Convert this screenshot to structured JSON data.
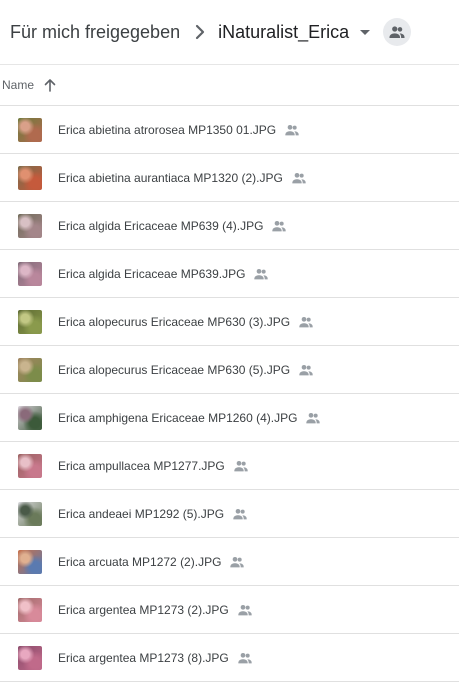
{
  "breadcrumb": {
    "root": "Für mich freigegeben",
    "current": "iNaturalist_Erica",
    "icons": {
      "separator": "chevron-right-icon",
      "dropdown": "caret-down-icon",
      "shared": "people-icon"
    }
  },
  "list_header": {
    "column_name": "Name",
    "sort_direction": "ascending",
    "sort_icon": "arrow-up-icon"
  },
  "files": [
    {
      "name": "Erica abietina atrorosea MP1350 01.JPG",
      "shared": true,
      "thumb_colors": [
        "#b06a4e",
        "#6e7a3c",
        "#d9a089"
      ]
    },
    {
      "name": "Erica abietina aurantiaca MP1320 (2).JPG",
      "shared": true,
      "thumb_colors": [
        "#c55a3c",
        "#7a6b4a",
        "#e09070"
      ]
    },
    {
      "name": "Erica algida Ericaceae MP639 (4).JPG",
      "shared": true,
      "thumb_colors": [
        "#a4868a",
        "#6f6a58",
        "#d8c0c4"
      ]
    },
    {
      "name": "Erica algida Ericaceae MP639.JPG",
      "shared": true,
      "thumb_colors": [
        "#b9879c",
        "#806a78",
        "#dcb6c6"
      ]
    },
    {
      "name": "Erica alopecurus Ericaceae MP630 (3).JPG",
      "shared": true,
      "thumb_colors": [
        "#8a9a4c",
        "#5d6a32",
        "#c2c884"
      ]
    },
    {
      "name": "Erica alopecurus Ericaceae MP630 (5).JPG",
      "shared": true,
      "thumb_colors": [
        "#7c8c4a",
        "#a08460",
        "#c9b48e"
      ]
    },
    {
      "name": "Erica amphigena Ericaceae MP1260 (4).JPG",
      "shared": true,
      "thumb_colors": [
        "#3c5a3a",
        "#d8d0d8",
        "#8a6a7a"
      ]
    },
    {
      "name": "Erica ampullacea MP1277.JPG",
      "shared": true,
      "thumb_colors": [
        "#c8788c",
        "#9a6060",
        "#e8c0c8"
      ]
    },
    {
      "name": "Erica andeaei MP1292 (5).JPG",
      "shared": true,
      "thumb_colors": [
        "#6a7a5a",
        "#d8d8dc",
        "#4a5a48"
      ]
    },
    {
      "name": "Erica arcuata MP1272 (2).JPG",
      "shared": true,
      "thumb_colors": [
        "#5a7ab0",
        "#c8704a",
        "#e0b090"
      ]
    },
    {
      "name": "Erica argentea MP1273 (2).JPG",
      "shared": true,
      "thumb_colors": [
        "#d88a9a",
        "#a06a6a",
        "#f0c0c8"
      ]
    },
    {
      "name": "Erica argentea MP1273 (8).JPG",
      "shared": true,
      "thumb_colors": [
        "#c06a8a",
        "#8a4a6a",
        "#e8a8c0"
      ]
    }
  ],
  "colors": {
    "text_primary": "#202124",
    "text_secondary": "#5f6368",
    "icon_grey": "#9aa0a6",
    "divider": "#e0e0e0"
  }
}
